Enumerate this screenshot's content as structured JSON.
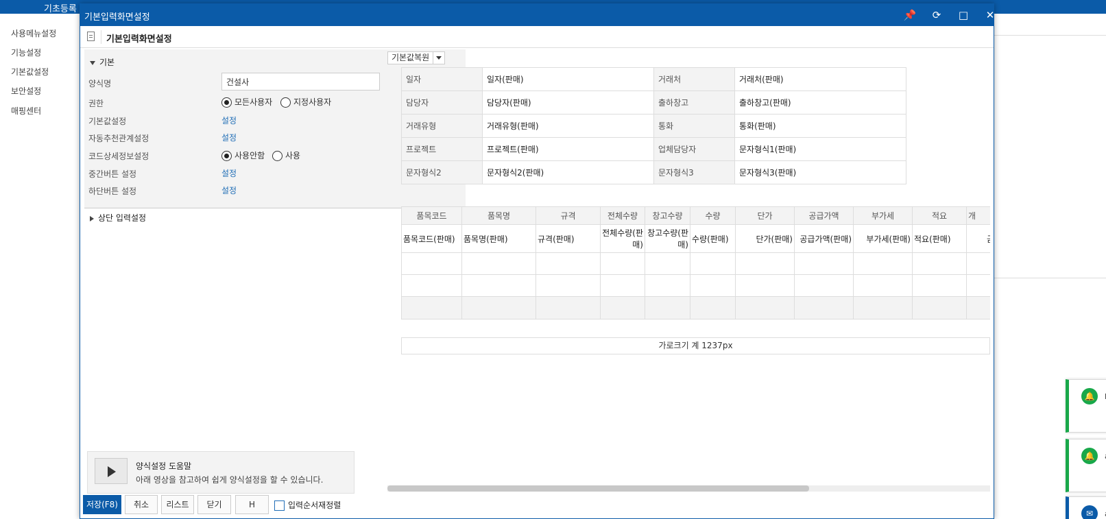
{
  "background": {
    "topbar_title": "기초등록",
    "sidebar_items": [
      "사용메뉴설정",
      "기능설정",
      "기본값설정",
      "보안설정",
      "매핑센터"
    ],
    "toasts": [
      "M",
      "a",
      "a"
    ]
  },
  "dialog": {
    "title": "기본입력화면설정",
    "titlebar_icons": [
      "pin-icon",
      "refresh-icon",
      "maximize-icon",
      "close-icon"
    ],
    "subheader_title": "기본입력화면설정"
  },
  "basic": {
    "section_title": "기본",
    "rows": {
      "form_name_label": "양식명",
      "form_name_value": "건설사",
      "permission_label": "권한",
      "permission_all": "모든사용자",
      "permission_specific": "지정사용자",
      "default_label": "기본값설정",
      "auto_label": "자동추천관계설정",
      "code_detail_label": "코드상세정보설정",
      "code_detail_off": "사용안함",
      "code_detail_on": "사용",
      "mid_button_label": "중간버튼 설정",
      "bottom_button_label": "하단버튼 설정",
      "link_text": "설정"
    },
    "section2_title": "상단 입력설정"
  },
  "help": {
    "title": "양식설정 도움말",
    "desc": "아래 영상을 참고하여 쉽게 양식설정을 할 수 있습니다."
  },
  "buttons": {
    "save": "저장(F8)",
    "cancel": "취소",
    "list": "리스트",
    "close": "닫기",
    "h": "H",
    "reorder": "입력순서재정렬"
  },
  "reset": {
    "label": "기본값복원"
  },
  "header_fields": [
    [
      {
        "label": "일자",
        "value": "일자(판매)"
      },
      {
        "label": "거래처",
        "value": "거래처(판매)"
      }
    ],
    [
      {
        "label": "담당자",
        "value": "담당자(판매)"
      },
      {
        "label": "출하창고",
        "value": "출하창고(판매)"
      }
    ],
    [
      {
        "label": "거래유형",
        "value": "거래유형(판매)"
      },
      {
        "label": "통화",
        "value": "통화(판매)"
      }
    ],
    [
      {
        "label": "프로젝트",
        "value": "프로젝트(판매)"
      },
      {
        "label": "업체담당자",
        "value": "문자형식1(판매)"
      }
    ],
    [
      {
        "label": "문자형식2",
        "value": "문자형식2(판매)"
      },
      {
        "label": "문자형식3",
        "value": "문자형식3(판매)"
      }
    ]
  ],
  "grid": {
    "columns": [
      "품목코드",
      "품목명",
      "규격",
      "전체수량",
      "창고수량",
      "수량",
      "단가",
      "공급가액",
      "부가세",
      "적요",
      "개"
    ],
    "values": [
      "품목코드(판매)",
      "품목명(판매)",
      "규격(판매)",
      "전체수량(판매)",
      "창고수량(판매)",
      "수량(판매)",
      "단가(판매)",
      "공급가액(판매)",
      "부가세(판매)",
      "적요(판매)",
      "금"
    ]
  },
  "width_total": "가로크기 계 1237px"
}
